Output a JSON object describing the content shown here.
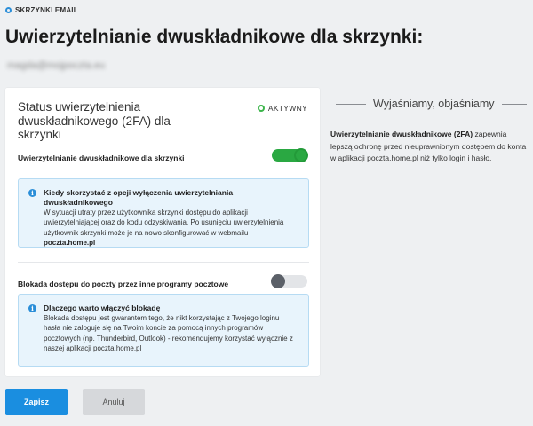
{
  "breadcrumb": {
    "label": "SKRZYNKI EMAIL",
    "icon": "circle-icon"
  },
  "page": {
    "title": "Uwierzytelnianie dwuskładnikowe dla skrzynki:",
    "email": "magda@mojpoczta.eu"
  },
  "card": {
    "title": "Status uwierzytelnienia dwuskładnikowego (2FA) dla skrzynki",
    "status": {
      "label": "AKTYWNY",
      "color": "#3bb54a"
    },
    "twofa_row": {
      "label": "Uwierzytelnianie dwuskładnikowe dla skrzynki",
      "enabled": true
    },
    "info1": {
      "title": "Kiedy skorzystać z opcji wyłączenia uwierzytelniania dwuskładnikowego",
      "text": "W sytuacji utraty przez użytkownika skrzynki dostępu do aplikacji uwierzytelniającej oraz do kodu odzyskiwania. Po usunięciu uwierzytelnienia użytkownik skrzynki może je na nowo skonfigurować w webmailu ",
      "strong": "poczta.home.pl"
    },
    "block_row": {
      "label": "Blokada dostępu do poczty przez inne programy pocztowe",
      "enabled": false
    },
    "info2": {
      "title": "Dlaczego warto włączyć blokadę",
      "text": "Blokada dostępu jest gwarantem tego, że nikt korzystając z Twojego loginu i hasła nie zaloguje się na Twoim koncie za pomocą innych programów pocztowych (np. Thunderbird, Outlook) - rekomendujemy korzystać wyłącznie z naszej aplikacji poczta.home.pl"
    }
  },
  "buttons": {
    "save": "Zapisz",
    "cancel": "Anuluj"
  },
  "explain": {
    "heading": "Wyjaśniamy, objaśniamy",
    "strong": "Uwierzytelnianie dwuskładnikowe (2FA)",
    "text": " zapewnia lepszą ochronę przed nieuprawnionym dostępem do konta w aplikacji poczta.home.pl niż tylko login i hasło."
  },
  "colors": {
    "accent": "#1a8ee0",
    "toggle_on": "#2aa842",
    "info_bg": "#e8f4fc"
  }
}
